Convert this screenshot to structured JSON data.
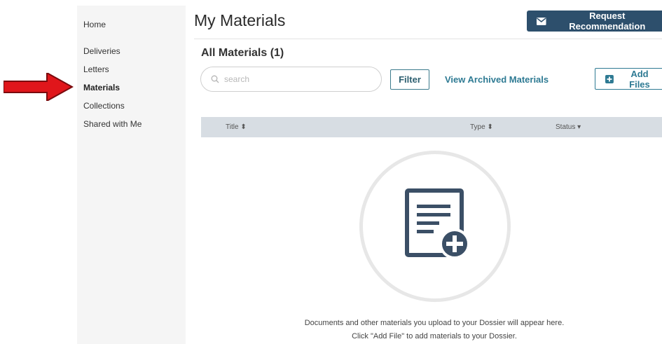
{
  "sidebar": {
    "items": [
      {
        "label": "Home",
        "active": false
      },
      {
        "label": "Deliveries",
        "active": false
      },
      {
        "label": "Letters",
        "active": false
      },
      {
        "label": "Materials",
        "active": true
      },
      {
        "label": "Collections",
        "active": false
      },
      {
        "label": "Shared with Me",
        "active": false
      }
    ]
  },
  "header": {
    "title": "My Materials",
    "request_button_label": "Request Recommendation",
    "request_button_icon": "envelope-icon"
  },
  "section": {
    "title": "All Materials (1)"
  },
  "toolbar": {
    "search_placeholder": "search",
    "search_value": "",
    "filter_label": "Filter",
    "archived_link_label": "View Archived Materials",
    "add_files_label": "Add Files",
    "add_files_icon": "plus-square-icon"
  },
  "table": {
    "columns": [
      {
        "label": "Title",
        "sort_icon": "⬍"
      },
      {
        "label": "Type",
        "sort_icon": "⬍"
      },
      {
        "label": "Status",
        "sort_icon": "▾"
      }
    ]
  },
  "empty_state": {
    "icon": "document-add-icon",
    "line1": "Documents and other materials you upload to your Dossier will appear here.",
    "line2": "Click \"Add File\" to add materials to your Dossier."
  },
  "annotation": {
    "icon": "red-arrow-icon",
    "color": "#e0161b"
  },
  "colors": {
    "primary": "#2d4f6c",
    "link": "#2e7a93",
    "table_header": "#d7dde3",
    "sidebar": "#f5f5f5"
  }
}
